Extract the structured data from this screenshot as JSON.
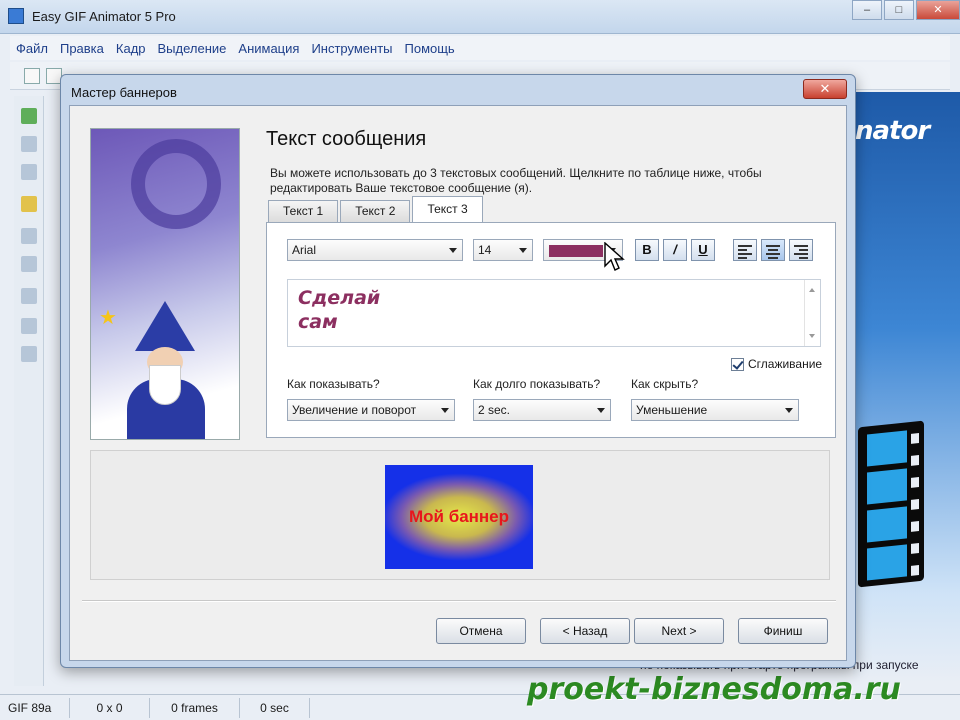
{
  "app": {
    "title": "Easy GIF Animator 5 Pro",
    "window_controls": {
      "minimize": "–",
      "maximize": "□",
      "close": "✕"
    },
    "menu": [
      "Файл",
      "Правка",
      "Кадр",
      "Выделение",
      "Анимация",
      "Инструменты",
      "Помощь"
    ],
    "background_logo_text": "nator",
    "background_partial_text": "не показывать при старте программы при запуске",
    "status": [
      "GIF 89a",
      "0 x 0",
      "0 frames",
      "0 sec"
    ]
  },
  "watermark": "proekt-biznesdoma.ru",
  "dialog": {
    "title": "Мастер баннеров",
    "close_glyph": "✕",
    "section_title": "Текст сообщения",
    "description": "Вы можете использовать до 3 текстовых сообщений. Щелкните по таблице ниже, чтобы редактировать Ваше текстовое сообщение (я).",
    "tabs": [
      {
        "label": "Текст 1",
        "active": false
      },
      {
        "label": "Текст 2",
        "active": false
      },
      {
        "label": "Текст 3",
        "active": true
      }
    ],
    "font": {
      "family": "Arial",
      "size": "14",
      "color": "#8c2f60"
    },
    "format_buttons": {
      "bold": "B",
      "italic": "/",
      "underline": "U"
    },
    "alignment": [
      "left",
      "center",
      "right"
    ],
    "alignment_selected": "center",
    "message_text": "Сделай\nсам",
    "smoothing": {
      "label": "Сглаживание",
      "checked": true
    },
    "show_how": {
      "label": "Как показывать?",
      "value": "Увеличение и поворот"
    },
    "show_duration": {
      "label": "Как долго показывать?",
      "value": "2 sec."
    },
    "hide_how": {
      "label": "Как скрыть?",
      "value": "Уменьшение"
    },
    "preview": {
      "banner_text": "Мой баннер",
      "banner_bg": "#1530e8",
      "banner_text_color": "#e8161c"
    },
    "buttons": {
      "cancel": "Отмена",
      "back": "< Назад",
      "next": "Next >",
      "finish": "Финиш"
    }
  }
}
